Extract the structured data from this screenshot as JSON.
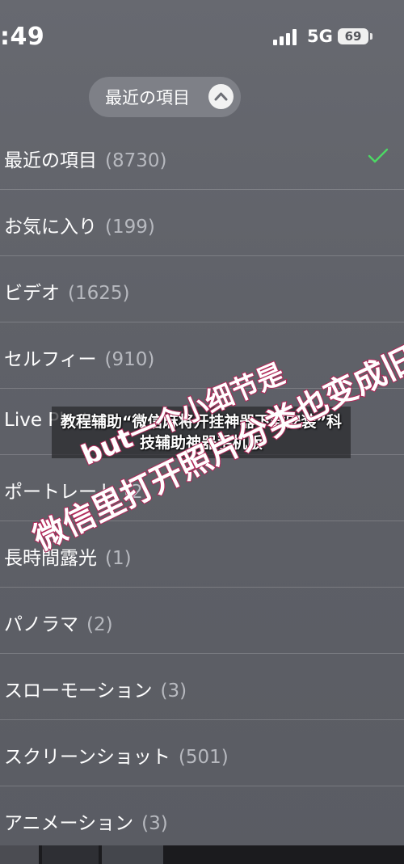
{
  "status_bar": {
    "time": ":49",
    "network": "5G",
    "battery": "69"
  },
  "album_selector": {
    "label": "最近の項目",
    "icon": "chevron-up-icon"
  },
  "albums": [
    {
      "name": "最近の項目",
      "count": "(8730)",
      "selected": true
    },
    {
      "name": "お気に入り",
      "count": "(199)"
    },
    {
      "name": "ビデオ",
      "count": "(1625)"
    },
    {
      "name": "セルフィー",
      "count": "(910)"
    },
    {
      "name": "Live Photos",
      "count": ""
    },
    {
      "name": "ポートレート",
      "count": "(2"
    },
    {
      "name": "長時間露光",
      "count": "(1)"
    },
    {
      "name": "パノラマ",
      "count": "(2)"
    },
    {
      "name": "スローモーション",
      "count": "(3)"
    },
    {
      "name": "スクリーンショット",
      "count": "(501)"
    },
    {
      "name": "アニメーション",
      "count": "(3)"
    }
  ],
  "banner": {
    "text": "教程辅助“微信麻将开挂神器下载安装”科技辅助神器手机版"
  },
  "annotations": {
    "line1": "but一个小细节是",
    "line2": "微信里打开照片分类也变成旧语"
  },
  "colors": {
    "background": "#5e6067",
    "checkmark": "#4cd964",
    "annotation_stroke": "#b02a5a"
  }
}
